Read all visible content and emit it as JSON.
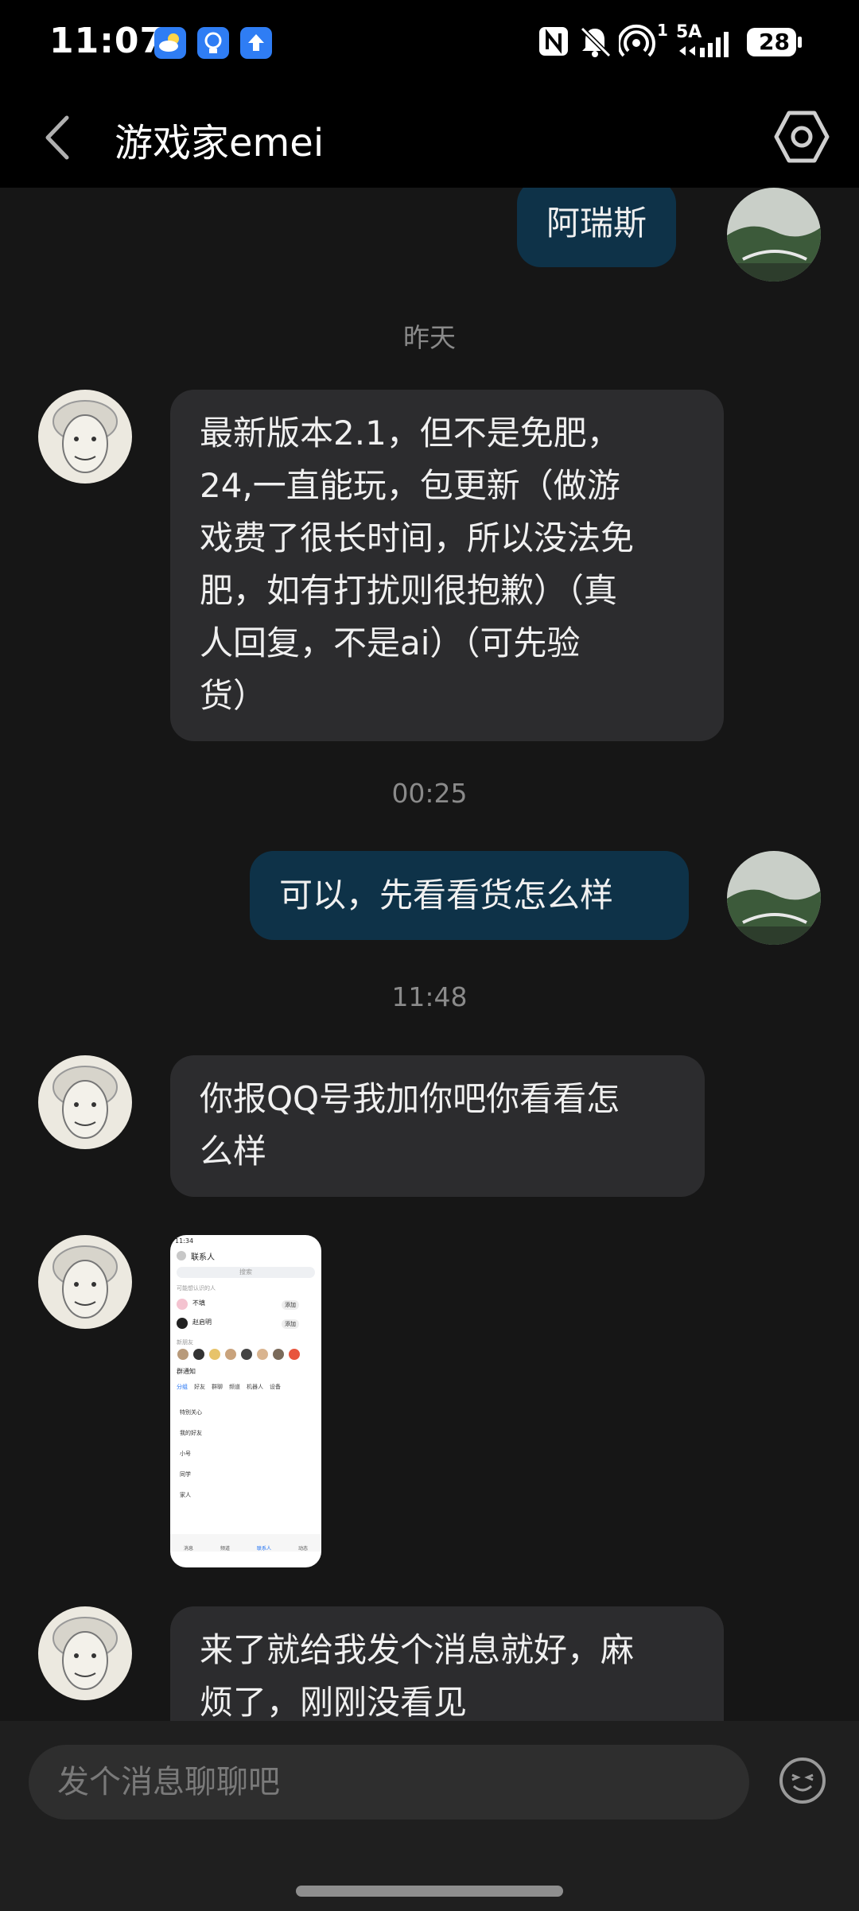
{
  "status_bar": {
    "time": "11:07",
    "network": "5A",
    "battery": "28",
    "hotspot_count": "1",
    "icons": [
      "weather-icon",
      "bulb-icon",
      "upload-icon",
      "nfc-icon",
      "mute-bell-icon",
      "hotspot-icon",
      "signal-icon",
      "battery-icon"
    ]
  },
  "header": {
    "title": "游戏家emei",
    "back_icon": "chevron-left-icon",
    "settings_icon": "hexagon-settings-icon"
  },
  "messages": [
    {
      "type": "outgoing",
      "text": "阿瑞斯"
    },
    {
      "type": "timestamp",
      "text": "昨天"
    },
    {
      "type": "incoming",
      "lines": [
        "最新版本2.1，但不是免肥，",
        "24,一直能玩，包更新（做游",
        "戏费了很长时间，所以没法免",
        "肥，如有打扰则很抱歉）（真",
        "人回复，不是ai）（可先验",
        "货）"
      ]
    },
    {
      "type": "timestamp",
      "text": "00:25"
    },
    {
      "type": "outgoing",
      "text": "可以，先看看货怎么样"
    },
    {
      "type": "timestamp",
      "text": "11:48"
    },
    {
      "type": "incoming",
      "lines": [
        "你报QQ号我加你吧你看看怎",
        "么样"
      ]
    },
    {
      "type": "incoming-image"
    },
    {
      "type": "incoming",
      "lines": [
        "来了就给我发个消息就好，麻",
        "烦了，刚刚没看见"
      ]
    }
  ],
  "shared_image": {
    "time": "11:34",
    "title": "联系人",
    "search": "搜索",
    "section": "可能想认识的人",
    "people": [
      {
        "name": "不填",
        "action": "添加"
      },
      {
        "name": "赵启明",
        "action": "添加"
      }
    ],
    "new_friends": "新朋友",
    "group_notice": "群通知",
    "tabs": [
      "分组",
      "好友",
      "群聊",
      "频道",
      "机器人",
      "设备"
    ],
    "groups": [
      "特别关心",
      "我的好友",
      "小号",
      "同学",
      "家人"
    ],
    "nav": [
      "消息",
      "频道",
      "联系人",
      "动态"
    ]
  },
  "input": {
    "placeholder": "发个消息聊聊吧",
    "emoji_icon": "emoji-icon"
  }
}
